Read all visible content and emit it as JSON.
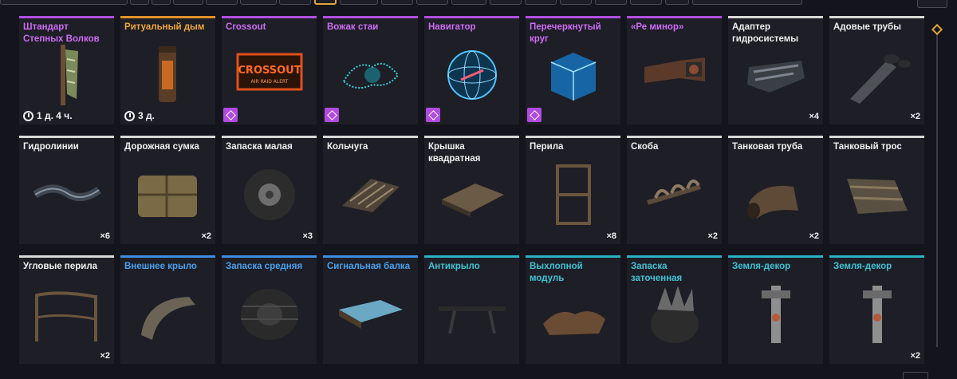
{
  "colors": {
    "epic": "#b04ee0",
    "legendary": "#e0902a",
    "common": "#d8d8d8",
    "rare": "#3d8ee0",
    "special": "#2ab3c6",
    "active_tab": "#e2a33a"
  },
  "items": [
    {
      "name": "Штандарт Степных Волков",
      "rarity": "purple",
      "icon": "banner-icon",
      "timer": "1 д. 4 ч."
    },
    {
      "name": "Ритуальный дым",
      "rarity": "orange",
      "icon": "smoke-canister-icon",
      "timer": "3 д."
    },
    {
      "name": "Crossout",
      "rarity": "purple",
      "icon": "crossout-sign-icon",
      "badge": true
    },
    {
      "name": "Вожак стаи",
      "rarity": "purple",
      "icon": "hologram-wolf-icon",
      "badge": true
    },
    {
      "name": "Навигатор",
      "rarity": "purple",
      "icon": "globe-hologram-icon",
      "badge": true
    },
    {
      "name": "Перечеркнутый круг",
      "rarity": "purple",
      "icon": "blue-cube-icon",
      "badge": true
    },
    {
      "name": "«Ре минор»",
      "rarity": "purple",
      "icon": "horn-icon"
    },
    {
      "name": "Адаптер гидросистемы",
      "rarity": "white",
      "icon": "hydraulic-adapter-icon",
      "qty": "×4"
    },
    {
      "name": "Адовые трубы",
      "rarity": "white",
      "icon": "exhaust-pipes-icon",
      "qty": "×2"
    },
    {
      "name": "Гидролинии",
      "rarity": "white",
      "icon": "hydraulic-lines-icon",
      "qty": "×6"
    },
    {
      "name": "Дорожная сумка",
      "rarity": "white",
      "icon": "travel-bag-icon",
      "qty": "×2"
    },
    {
      "name": "Запаска малая",
      "rarity": "white",
      "icon": "small-tire-icon",
      "qty": "×3"
    },
    {
      "name": "Кольчуга",
      "rarity": "white",
      "icon": "chainmail-icon"
    },
    {
      "name": "Крышка квадратная",
      "rarity": "white",
      "icon": "square-lid-icon"
    },
    {
      "name": "Перила",
      "rarity": "white",
      "icon": "railing-icon",
      "qty": "×8"
    },
    {
      "name": "Скоба",
      "rarity": "white",
      "icon": "bracket-icon",
      "qty": "×2"
    },
    {
      "name": "Танковая труба",
      "rarity": "white",
      "icon": "tank-pipe-icon",
      "qty": "×2"
    },
    {
      "name": "Танковый трос",
      "rarity": "white",
      "icon": "tank-cable-icon"
    },
    {
      "name": "Угловые перила",
      "rarity": "white",
      "icon": "corner-railing-icon",
      "qty": "×2"
    },
    {
      "name": "Внешнее крыло",
      "rarity": "blue",
      "icon": "fender-icon"
    },
    {
      "name": "Запаска средняя",
      "rarity": "blue",
      "icon": "medium-tire-icon"
    },
    {
      "name": "Сигнальная балка",
      "rarity": "blue",
      "icon": "signal-beam-icon"
    },
    {
      "name": "Антикрыло",
      "rarity": "teal",
      "icon": "spoiler-icon"
    },
    {
      "name": "Выхлопной модуль",
      "rarity": "teal",
      "icon": "exhaust-module-icon"
    },
    {
      "name": "Запаска заточенная",
      "rarity": "teal",
      "icon": "sharpened-tire-icon"
    },
    {
      "name": "Земля-декор",
      "rarity": "teal",
      "icon": "earth-decor-icon"
    },
    {
      "name": "Земля-декор",
      "rarity": "teal",
      "icon": "earth-decor-icon",
      "qty": "×2"
    }
  ]
}
